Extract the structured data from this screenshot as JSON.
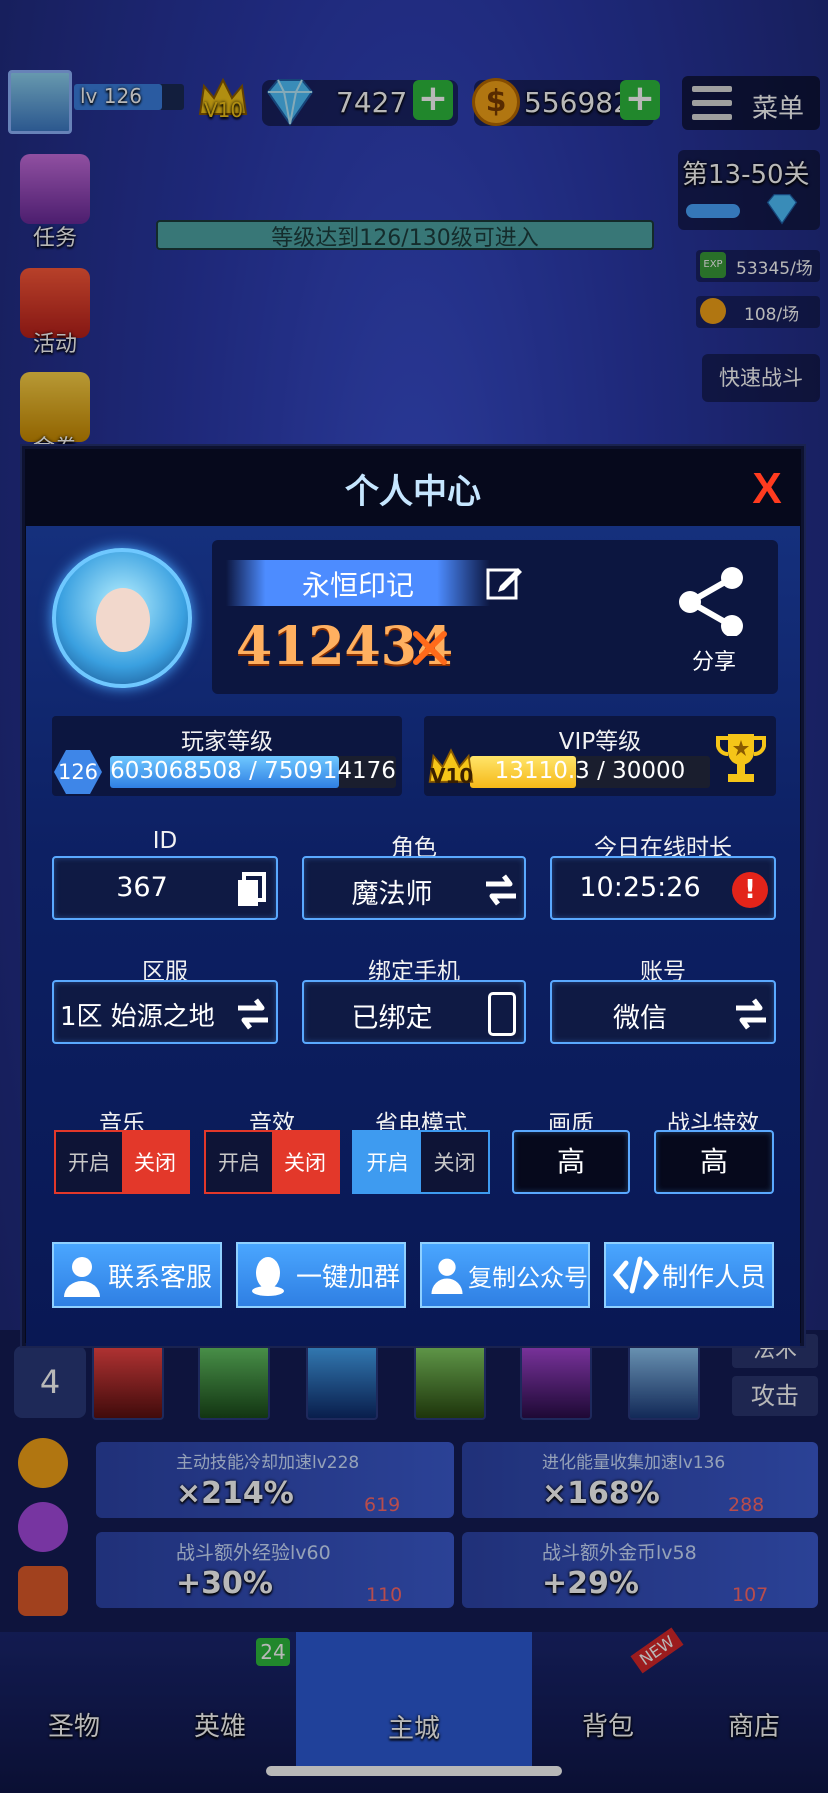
{
  "topbar": {
    "level": "lv 126",
    "vip": "V10",
    "diamonds": "7427",
    "gold": "556982",
    "menu_label": "菜单"
  },
  "side_left": [
    {
      "label": "任务",
      "icon": "task-icon"
    },
    {
      "label": "活动",
      "icon": "gift-icon"
    },
    {
      "label": "金卷",
      "icon": "ticket-icon"
    }
  ],
  "stage": {
    "title": "第13-50关",
    "exp_rate": "53345/场",
    "gold_rate": "108/场",
    "quick_battle": "快速战斗",
    "level_notice": "等级达到126/130级可进入"
  },
  "panel": {
    "title": "个人中心",
    "close_symbol": "X",
    "nickname": "永恒印记",
    "power": "412434",
    "share_label": "分享",
    "player_level_title": "玩家等级",
    "player_level": "126",
    "player_exp": "603068508 / 750914176",
    "player_exp_fraction": 0.8,
    "vip_level_title": "VIP等级",
    "vip_level": "V10",
    "vip_exp": "13110.3 / 30000",
    "vip_exp_fraction": 0.44,
    "fields": {
      "id_label": "ID",
      "id_value": "367",
      "role_label": "角色",
      "role_value": "魔法师",
      "online_label": "今日在线时长",
      "online_value": "10:25:26",
      "server_label": "区服",
      "server_value": "1区 始源之地",
      "phone_label": "绑定手机",
      "phone_value": "已绑定",
      "account_label": "账号",
      "account_value": "微信"
    },
    "settings": {
      "music_label": "音乐",
      "sfx_label": "音效",
      "power_save_label": "省电模式",
      "quality_label": "画质",
      "quality_value": "高",
      "battle_fx_label": "战斗特效",
      "battle_fx_value": "高",
      "on": "开启",
      "off": "关闭"
    },
    "actions": {
      "support": "联系客服",
      "join_group": "一键加群",
      "copy_account": "复制公众号",
      "credits": "制作人员"
    }
  },
  "bottom": {
    "skill_count": "4",
    "side_tabs": [
      "法术",
      "攻击"
    ],
    "buffs": [
      {
        "title": "主动技能冷却加速lv228",
        "value": "×214%",
        "cost": "619"
      },
      {
        "title": "进化能量收集加速lv136",
        "value": "×168%",
        "cost": "288"
      },
      {
        "title": "战斗额外经验lv60",
        "value": "+30%",
        "cost": "110"
      },
      {
        "title": "战斗额外金币lv58",
        "value": "+29%",
        "cost": "107"
      }
    ],
    "nav": [
      {
        "label": "圣物"
      },
      {
        "label": "英雄",
        "badge": "24"
      },
      {
        "label": "主城"
      },
      {
        "label": "背包",
        "badge": "NEW"
      },
      {
        "label": "商店"
      }
    ]
  },
  "colors": {
    "accent_blue": "#3e9bf0",
    "off_red": "#e3382a",
    "gold": "#f5c518",
    "border_blue": "#5aa9ff"
  }
}
